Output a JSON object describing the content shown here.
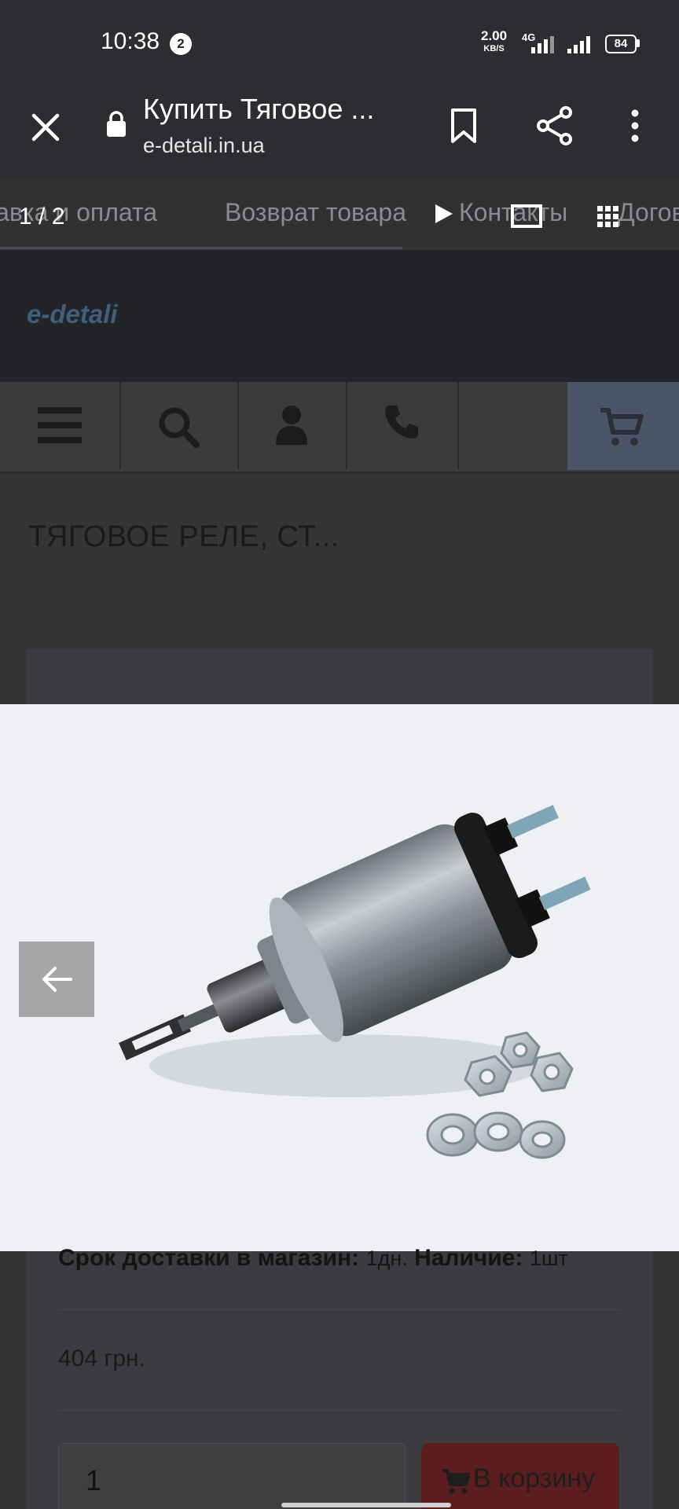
{
  "status_bar": {
    "time": "10:38",
    "notification_count": "2",
    "net_speed": "2.00",
    "net_speed_unit": "KB/S",
    "network_type": "4G",
    "battery": "84"
  },
  "browser": {
    "page_title": "Купить Тяговое ...",
    "url": "e-detali.in.ua",
    "icons": [
      "close-icon",
      "lock-icon",
      "bookmark-icon",
      "share-icon",
      "more-vert-icon"
    ]
  },
  "viewer": {
    "counter": "1 / 2",
    "icons": [
      "play-icon",
      "cast-icon",
      "grid-icon"
    ]
  },
  "site": {
    "menu_links": [
      "Доставка и оплата",
      "Возврат товара",
      "Контакты",
      "Договор"
    ],
    "logo": "e-detali",
    "nav_icons": [
      "menu-icon",
      "search-icon",
      "user-icon",
      "phone-icon",
      "cart-icon"
    ],
    "product_title": "ТЯГОВОЕ РЕЛЕ, СТ...",
    "delivery_label": "Срок доставки в магазин:",
    "delivery_value": "1дн.",
    "stock_label": "Наличие:",
    "stock_value": "1шт",
    "price": "404 грн.",
    "quantity": "1",
    "add_to_cart": "В корзину"
  },
  "colors": {
    "status_bar": "#2b2d31",
    "page_dim": "#343537",
    "cart_cell": "#4a5667",
    "cart_button": "#5c1d1f",
    "image_background": "#eef0f3"
  }
}
